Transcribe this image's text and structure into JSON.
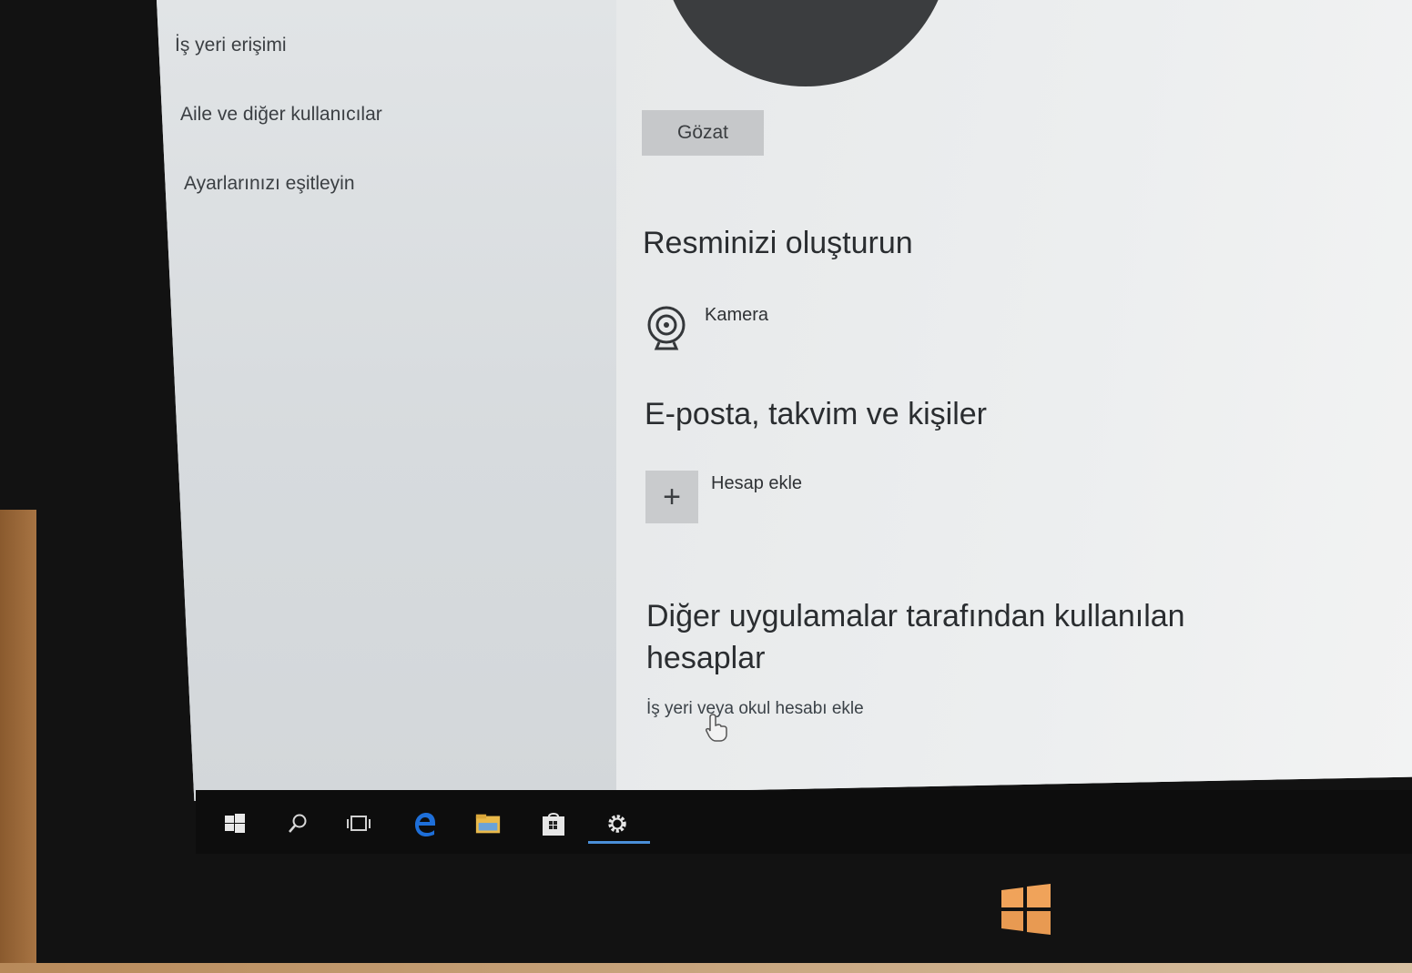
{
  "sidebar": {
    "items": [
      {
        "label": "İş yeri erişimi"
      },
      {
        "label": "Aile ve diğer kullanıcılar"
      },
      {
        "label": "Ayarlarınızı eşitleyin"
      }
    ]
  },
  "main": {
    "browse_label": "Gözat",
    "create_picture": {
      "title": "Resminizi oluşturun",
      "camera_label": "Kamera",
      "camera_icon": "webcam-icon"
    },
    "email_section": {
      "title": "E-posta, takvim ve kişiler",
      "add_account_label": "Hesap ekle",
      "add_icon": "plus-icon"
    },
    "other_apps_section": {
      "title": "Diğer uygulamalar tarafından kullanılan hesaplar",
      "work_link": "İş yeri veya okul hesabı ekle"
    }
  },
  "taskbar": {
    "icons": [
      "windows-start-icon",
      "search-icon",
      "task-view-icon",
      "edge-icon",
      "file-explorer-icon",
      "store-icon",
      "settings-icon"
    ],
    "active": "settings-icon",
    "accent": "#4a8fd8"
  },
  "colors": {
    "content_bg": "#eceeef",
    "sidebar_bg": "#dadde0",
    "taskbar_bg": "#0d0d0d",
    "edge_blue": "#1e6fd9"
  }
}
